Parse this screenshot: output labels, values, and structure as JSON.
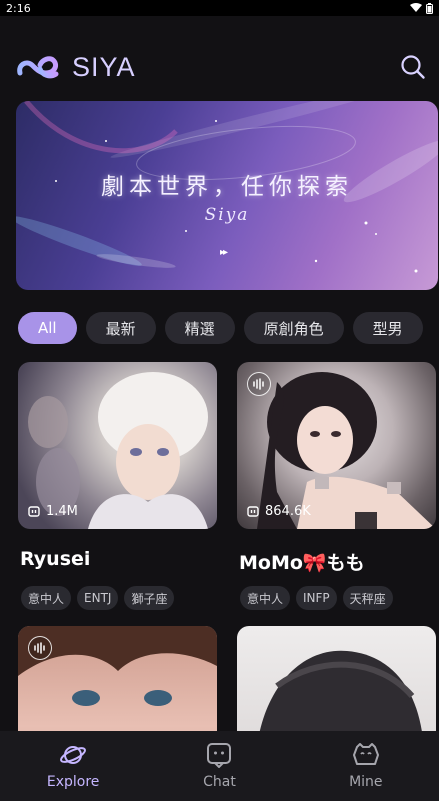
{
  "status": {
    "time": "2:16"
  },
  "app": {
    "name": "SIYA"
  },
  "banner": {
    "title": "劇本世界，任你探索",
    "subtitle": "Siya"
  },
  "chips": [
    "All",
    "最新",
    "精選",
    "原創角色",
    "型男"
  ],
  "cards": [
    {
      "name": "Ryusei",
      "count": "1.4M",
      "tags": [
        "意中人",
        "ENTJ",
        "獅子座"
      ],
      "voice": false
    },
    {
      "name": "MoMo🎀もも",
      "count": "864.6K",
      "tags": [
        "意中人",
        "INFP",
        "天秤座"
      ],
      "voice": true
    }
  ],
  "nav": {
    "explore": "Explore",
    "chat": "Chat",
    "mine": "Mine"
  },
  "colors": {
    "accent": "#a893e8",
    "background": "#121114"
  }
}
